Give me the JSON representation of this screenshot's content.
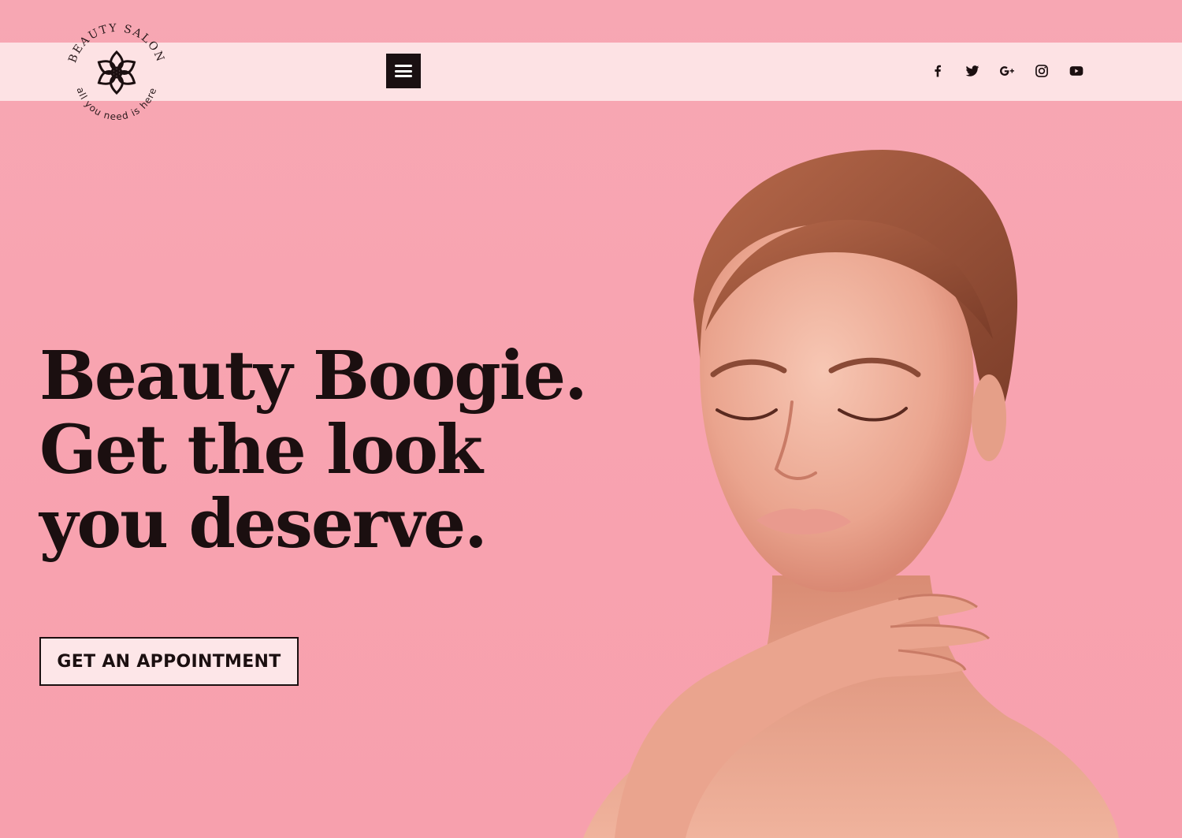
{
  "brand": {
    "top_text": "BEAUTY SALON",
    "bottom_text": "all you need is here",
    "icon": "flower-icon"
  },
  "nav": {
    "menu_icon": "hamburger-menu-icon"
  },
  "social": [
    {
      "name": "facebook",
      "icon": "facebook-icon"
    },
    {
      "name": "twitter",
      "icon": "twitter-icon"
    },
    {
      "name": "google-plus",
      "icon": "google-plus-icon"
    },
    {
      "name": "instagram",
      "icon": "instagram-icon"
    },
    {
      "name": "youtube",
      "icon": "youtube-icon"
    }
  ],
  "hero": {
    "headline_lines": [
      "Beauty Boogie.",
      "Get the look",
      "you deserve."
    ],
    "cta_label": "GET AN APPOINTMENT",
    "image": "model-portrait"
  },
  "colors": {
    "background": "#f8a3b0",
    "header_bar": "#fde2e4",
    "text_dark": "#1b0f10",
    "button_bg": "#fde6e8"
  }
}
